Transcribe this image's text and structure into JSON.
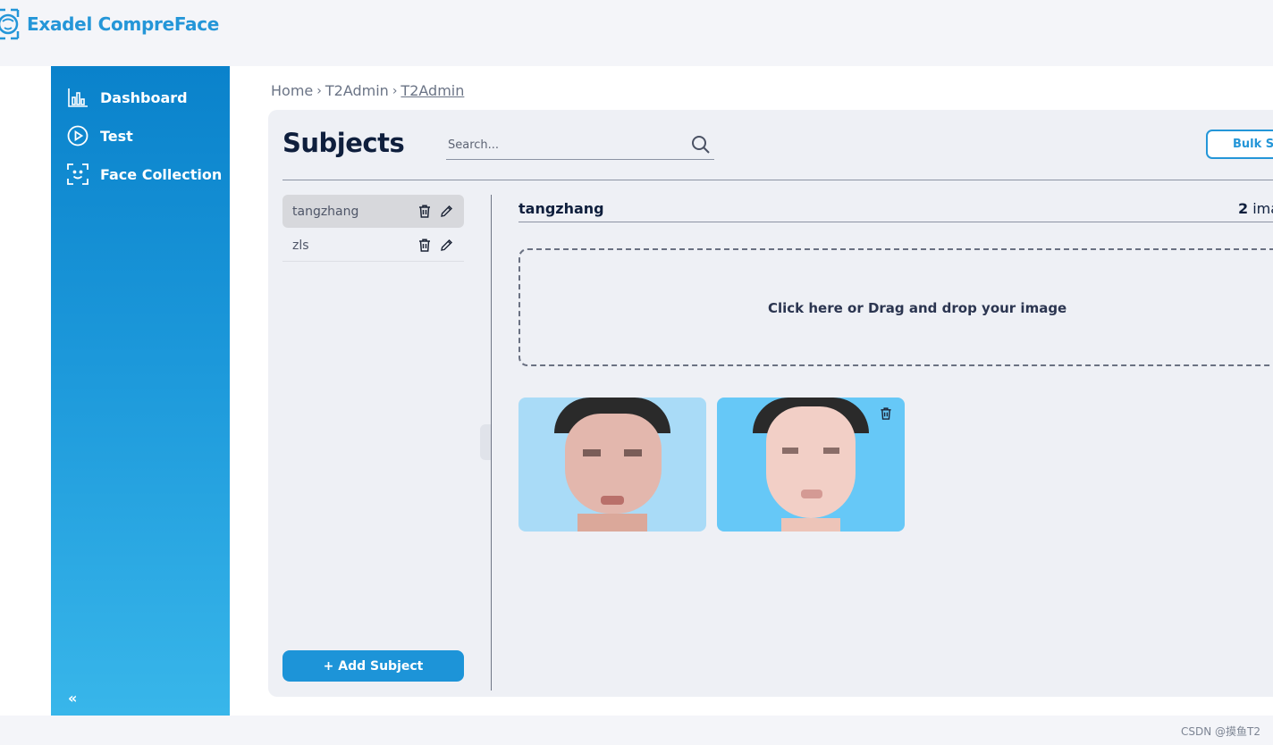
{
  "app": {
    "title": "Exadel CompreFace",
    "brand_color": "#2496d8"
  },
  "sidebar": {
    "items": [
      {
        "label": "Dashboard",
        "icon": "bar-chart-icon"
      },
      {
        "label": "Test",
        "icon": "play-circle-icon"
      },
      {
        "label": "Face Collection",
        "icon": "face-scan-icon"
      }
    ],
    "collapse_label": "«"
  },
  "breadcrumb": {
    "items": [
      "Home",
      "T2Admin",
      "T2Admin"
    ],
    "separator": "›"
  },
  "subjects_page": {
    "title": "Subjects",
    "search_placeholder": "Search...",
    "bulk_button_label": "Bulk Se",
    "subjects": [
      {
        "name": "tangzhang",
        "selected": true
      },
      {
        "name": "zls",
        "selected": false
      }
    ],
    "add_subject_label": "+ Add Subject"
  },
  "detail": {
    "subject_name": "tangzhang",
    "image_count": "2",
    "image_count_suffix": "ima",
    "dropzone_text": "Click here or Drag and drop your image",
    "images": [
      {
        "name": "face-image-1",
        "background": "#a9dbf7"
      },
      {
        "name": "face-image-2",
        "background": "#66c8f7"
      }
    ]
  },
  "footer": {
    "watermark": "CSDN @摸鱼T2"
  }
}
